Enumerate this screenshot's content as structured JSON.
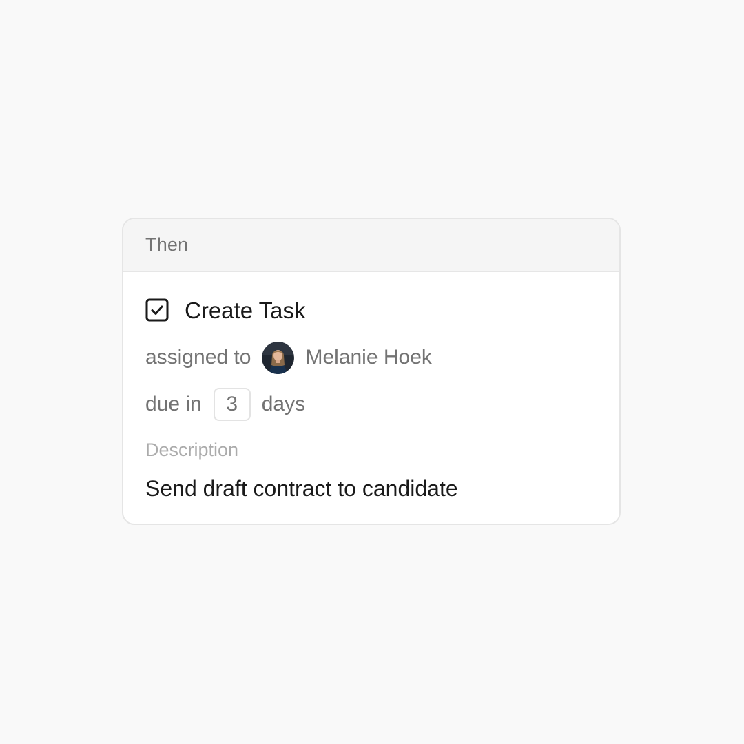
{
  "header": {
    "label": "Then"
  },
  "task": {
    "icon": "checkbox-checked-icon",
    "title": "Create Task",
    "assigned_label": "assigned to",
    "assignee_name": "Melanie Hoek",
    "due_prefix": "due in",
    "due_value": "3",
    "due_suffix": "days",
    "description_label": "Description",
    "description_text": "Send draft contract to candidate"
  },
  "colors": {
    "background": "#f9f9f9",
    "card": "#ffffff",
    "header_bg": "#f5f5f5",
    "border": "#e5e5e5",
    "text_primary": "#1a1a1a",
    "text_muted": "#737373",
    "text_faint": "#ababab"
  }
}
